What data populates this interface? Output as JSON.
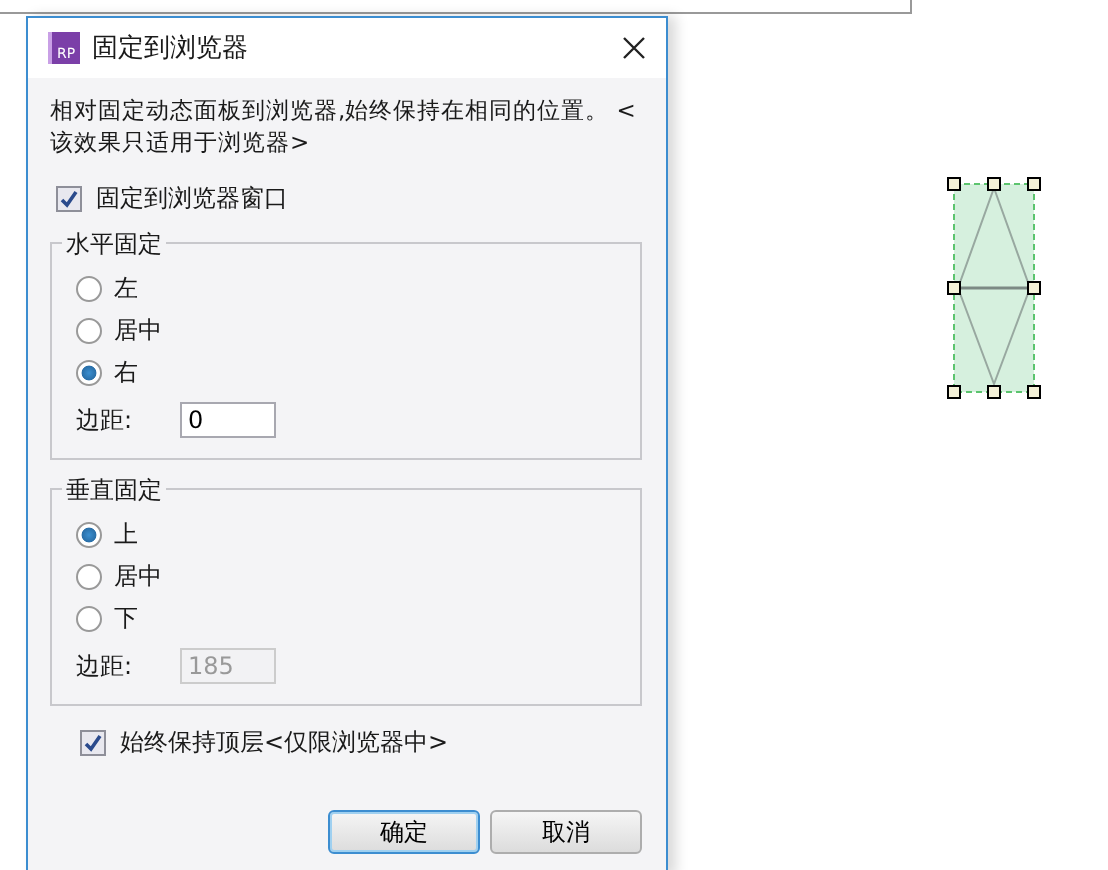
{
  "dialog": {
    "app_icon": "RP",
    "title": "固定到浏览器",
    "description": "相对固定动态面板到浏览器,始终保持在相同的位置。 <该效果只适用于浏览器>",
    "pin_checkbox": {
      "label": "固定到浏览器窗口",
      "checked": true
    },
    "groups": [
      {
        "title": "水平固定",
        "options": [
          {
            "label": "左",
            "selected": false
          },
          {
            "label": "居中",
            "selected": false
          },
          {
            "label": "右",
            "selected": true
          }
        ],
        "margin": {
          "label": "边距:",
          "value": "0",
          "disabled": false
        }
      },
      {
        "title": "垂直固定",
        "options": [
          {
            "label": "上",
            "selected": true
          },
          {
            "label": "居中",
            "selected": false
          },
          {
            "label": "下",
            "selected": false
          }
        ],
        "margin": {
          "label": "边距:",
          "value": "185",
          "disabled": true
        }
      }
    ],
    "top_checkbox": {
      "label": "始终保持顶层<仅限浏览器中>",
      "checked": true
    },
    "buttons": [
      {
        "label": "确定",
        "default": true
      },
      {
        "label": "取消",
        "default": false
      }
    ]
  }
}
